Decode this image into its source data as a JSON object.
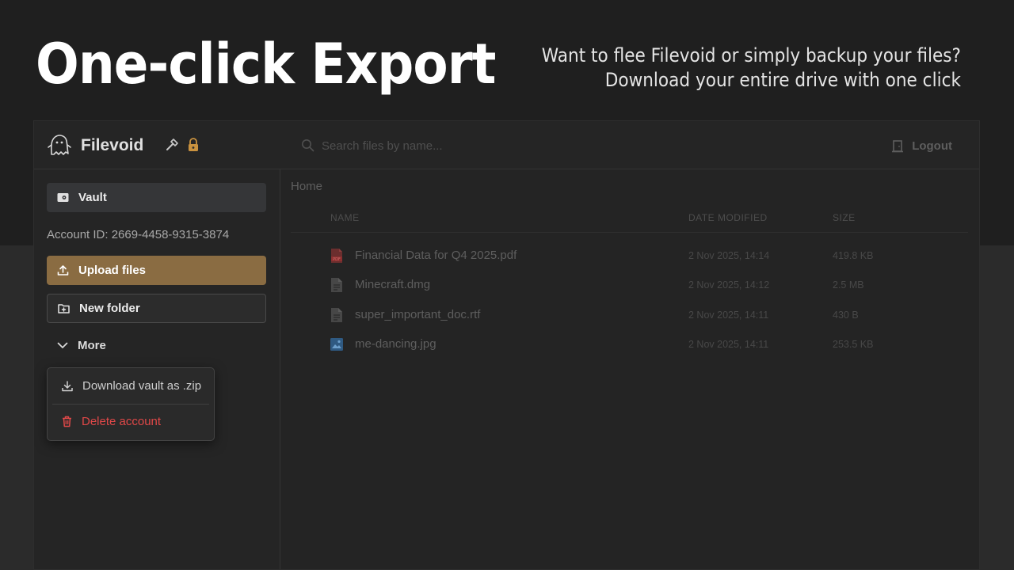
{
  "hero": {
    "title": "One-click Export",
    "subtitle_line1": "Want to flee Filevoid or simply backup your files?",
    "subtitle_line2": "Download your entire drive with one click"
  },
  "app": {
    "brand": "Filevoid",
    "icons": {
      "logo": "ghost-icon",
      "admin": "hammer-icon",
      "lock": "lock-icon",
      "search": "search-icon",
      "logout": "door-icon"
    },
    "search": {
      "placeholder": "Search files by name..."
    },
    "logout_label": "Logout",
    "accent_color": "#8a6c42",
    "danger_color": "#e04848"
  },
  "sidebar": {
    "vault_label": "Vault",
    "account_id": "Account ID: 2669-4458-9315-3874",
    "upload_label": "Upload files",
    "new_folder_label": "New folder",
    "more_label": "More",
    "menu": {
      "download_label": "Download vault as .zip",
      "delete_label": "Delete account"
    }
  },
  "main": {
    "breadcrumb": "Home",
    "columns": {
      "name": "NAME",
      "date": "DATE MODIFIED",
      "size": "SIZE"
    },
    "files": [
      {
        "name": "Financial Data for Q4 2025.pdf",
        "date": "2 Nov 2025, 14:14",
        "size": "419.8 KB",
        "icon": "pdf-icon"
      },
      {
        "name": "Minecraft.dmg",
        "date": "2 Nov 2025, 14:12",
        "size": "2.5 MB",
        "icon": "file-icon"
      },
      {
        "name": "super_important_doc.rtf",
        "date": "2 Nov 2025, 14:11",
        "size": "430 B",
        "icon": "file-icon"
      },
      {
        "name": "me-dancing.jpg",
        "date": "2 Nov 2025, 14:11",
        "size": "253.5 KB",
        "icon": "image-icon"
      }
    ]
  }
}
